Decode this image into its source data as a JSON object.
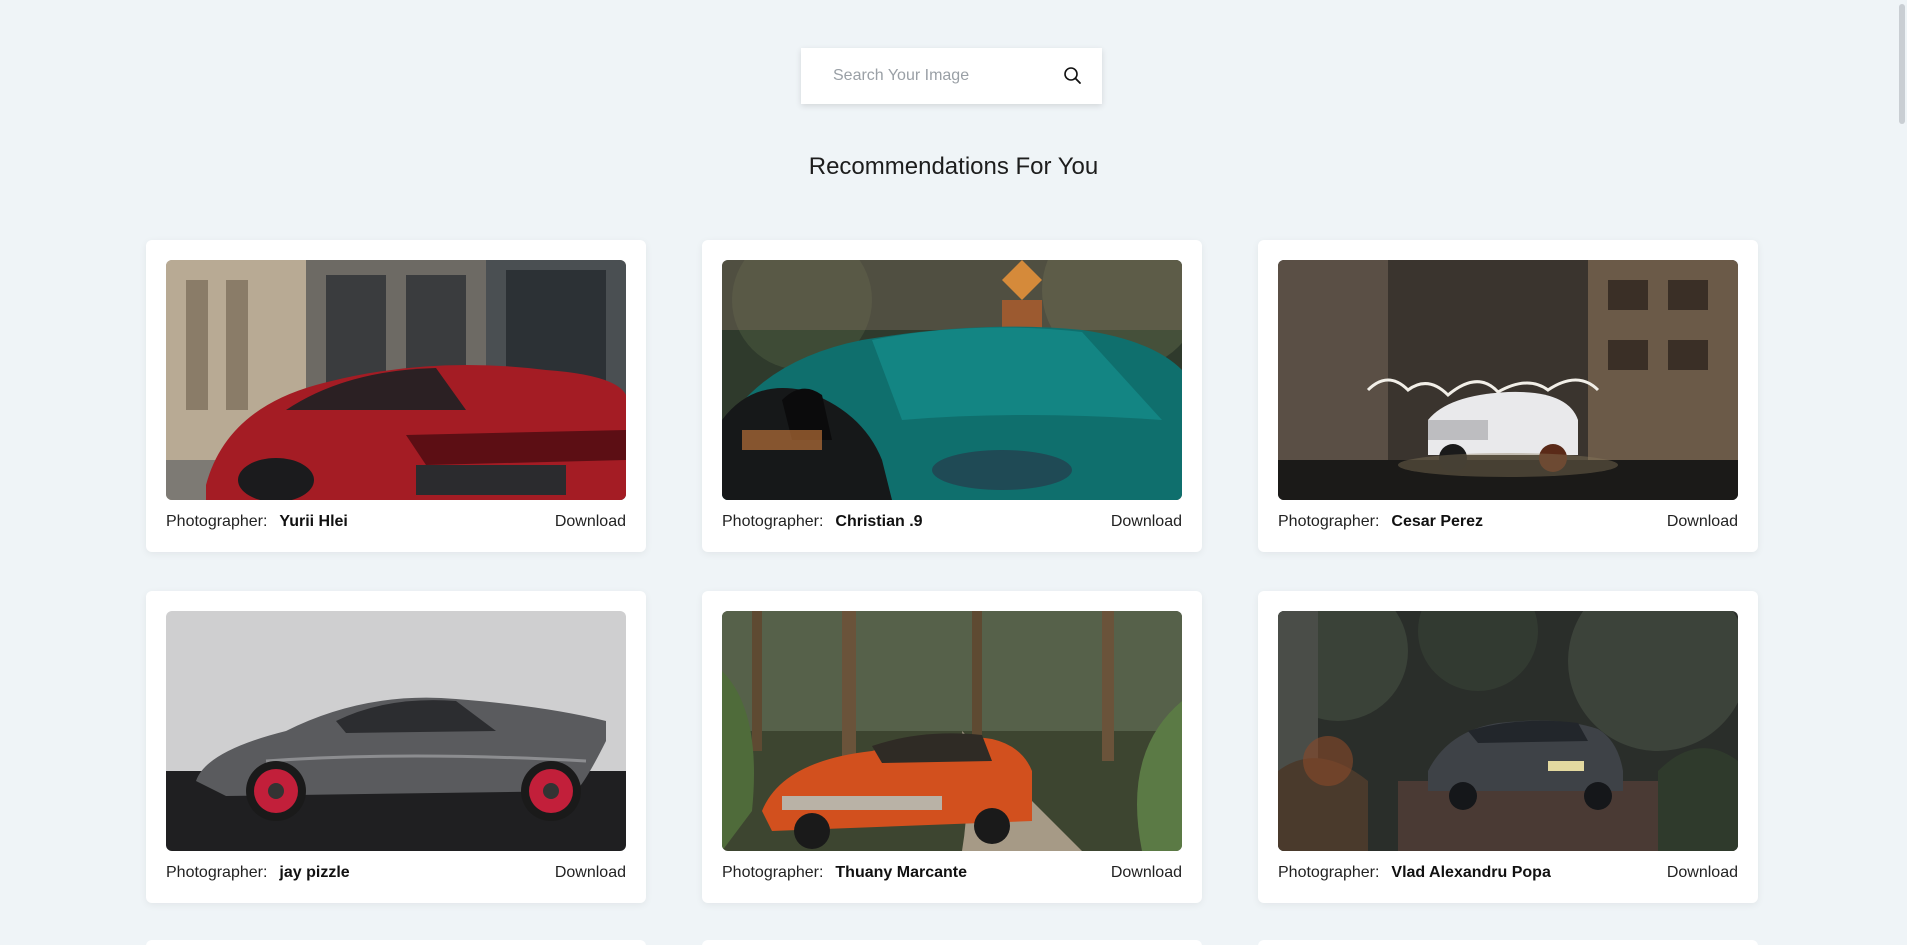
{
  "search": {
    "placeholder": "Search Your Image",
    "icon": "search-icon"
  },
  "section": {
    "title": "Recommendations For You"
  },
  "cards": [
    {
      "photographer_label": "Photographer:",
      "photographer": "Yurii Hlei",
      "download_label": "Download",
      "image": "red-sports-car-street"
    },
    {
      "photographer_label": "Photographer:",
      "photographer": "Christian .9",
      "download_label": "Download",
      "image": "teal-car-closeup"
    },
    {
      "photographer_label": "Photographer:",
      "photographer": "Cesar Perez",
      "download_label": "Download",
      "image": "white-muscle-car-light-painting"
    },
    {
      "photographer_label": "Photographer:",
      "photographer": "jay pizzle",
      "download_label": "Download",
      "image": "grey-lamborghini-side"
    },
    {
      "photographer_label": "Photographer:",
      "photographer": "Thuany Marcante",
      "download_label": "Download",
      "image": "orange-mustang-forest"
    },
    {
      "photographer_label": "Photographer:",
      "photographer": "Vlad Alexandru Popa",
      "download_label": "Download",
      "image": "dark-audi-garden"
    }
  ],
  "colors": {
    "background": "#eff4f7",
    "card": "#ffffff"
  }
}
